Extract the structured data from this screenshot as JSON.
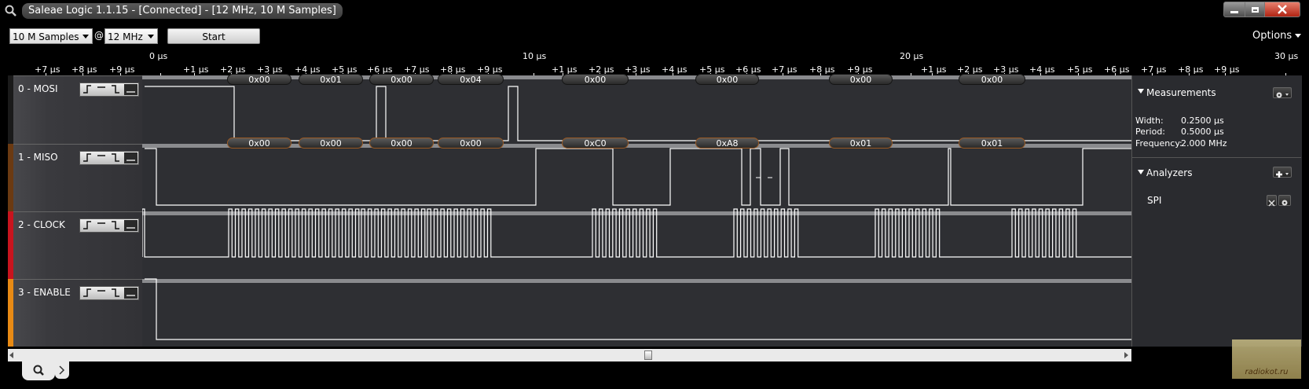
{
  "window": {
    "title": "Saleae Logic 1.1.15 - [Connected] - [12 MHz, 10 M Samples]",
    "icons": [
      "search-icon",
      "minimize-icon",
      "maximize-icon",
      "close-icon"
    ]
  },
  "toolbar": {
    "samples": "10 M Samples",
    "at": "@",
    "rate": "12 MHz",
    "start_label": "Start",
    "options_label": "Options"
  },
  "ruler": {
    "labels": [
      "+7 µs",
      "+8 µs",
      "+9 µs",
      "0 µs",
      "+1 µs",
      "+2 µs",
      "+3 µs",
      "+4 µs",
      "+5 µs",
      "+6 µs",
      "+7 µs",
      "+8 µs",
      "+9 µs",
      "10 µs",
      "+1 µs",
      "+2 µs",
      "+3 µs",
      "+4 µs",
      "+5 µs",
      "+6 µs",
      "+7 µs",
      "+8 µs",
      "+9 µs",
      "20 µs",
      "+1 µs",
      "+2 µs",
      "+3 µs",
      "+4 µs",
      "+5 µs",
      "+6 µs",
      "+7 µs",
      "+8 µs",
      "+9 µs",
      "30 µs"
    ]
  },
  "channels": [
    {
      "name": "0 - MOSI",
      "color": "#1a1a1a"
    },
    {
      "name": "1 - MISO",
      "color": "#6b3a12"
    },
    {
      "name": "2 - CLOCK",
      "color": "#c8141e"
    },
    {
      "name": "3 - ENABLE",
      "color": "#e88a14"
    }
  ],
  "mosi_bytes": [
    "0x00",
    "0x01",
    "0x00",
    "0x04",
    "0x00",
    "0x00",
    "0x00",
    "0x00"
  ],
  "miso_bytes": [
    "0x00",
    "0x00",
    "0x00",
    "0x00",
    "0xC0",
    "0xA8",
    "0x01",
    "0x01"
  ],
  "measurements": {
    "title": "Measurements",
    "width_label": "Width:",
    "width_value": "0.2500 µs",
    "period_label": "Period:",
    "period_value": "0.5000 µs",
    "frequency_label": "Frequency:",
    "frequency_value": "2.000 MHz"
  },
  "analyzers": {
    "title": "Analyzers",
    "items": [
      {
        "label": "SPI"
      }
    ]
  },
  "watermark": "radiokot.ru",
  "colors": {
    "trace_bg": "#2e2f33",
    "signal": "#ffffff",
    "miso_accent": "#9a5a24"
  }
}
